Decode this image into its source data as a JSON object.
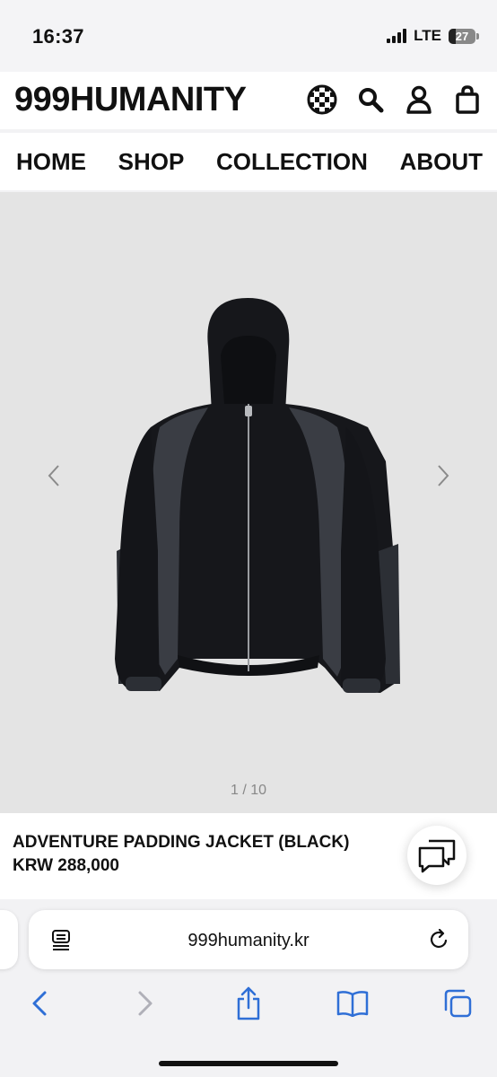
{
  "status": {
    "time": "16:37",
    "network": "LTE",
    "battery": "27",
    "battery_level": 0.27
  },
  "header": {
    "logo": "999HUMANITY",
    "icons": [
      "globe-icon",
      "search-icon",
      "user-icon",
      "bag-icon"
    ]
  },
  "nav": {
    "items": [
      "HOME",
      "SHOP",
      "COLLECTION",
      "ABOUT"
    ]
  },
  "gallery": {
    "counter": "1 / 10",
    "current": 1,
    "total": 10,
    "icons": [
      "chevron-left-icon",
      "chevron-right-icon"
    ]
  },
  "product": {
    "name": "ADVENTURE PADDING JACKET (BLACK)",
    "price": "KRW 288,000"
  },
  "browser": {
    "url": "999humanity.kr",
    "toolbar_icons": [
      "back-icon",
      "forward-icon",
      "share-icon",
      "bookmarks-icon",
      "tabs-icon"
    ]
  },
  "colors": {
    "accent": "#2f6fd6",
    "disabled": "#b0b0b8",
    "gallery_bg": "#e4e4e4",
    "jacket": "#16171b",
    "panel": "#3a3d44"
  }
}
